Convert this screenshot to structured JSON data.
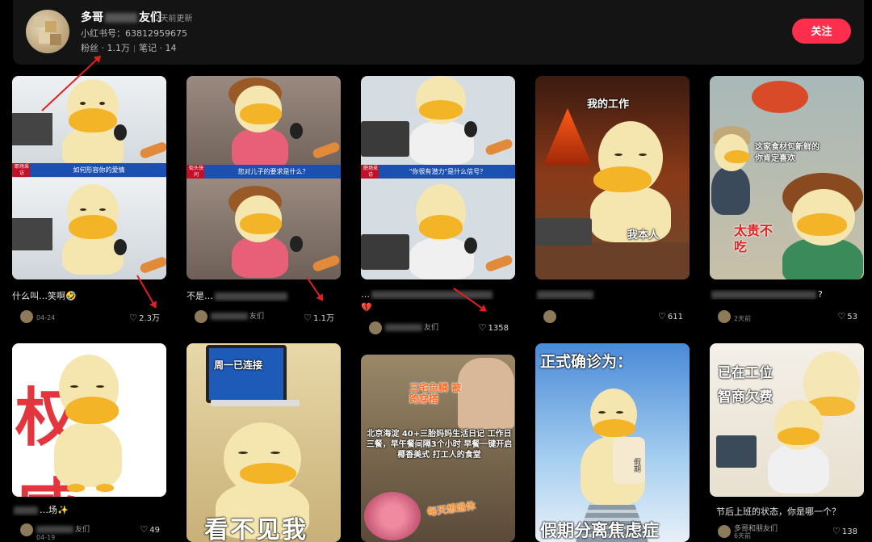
{
  "profile": {
    "name_prefix": "多哥",
    "name_suffix": "友们",
    "updated": "2天前更新",
    "id_text": "小红书号：63812959675",
    "fans": "粉丝 · 1.1万",
    "notes": "笔记 · 14",
    "follow_label": "关注"
  },
  "cards": [
    {
      "banner_tag": "职场采访",
      "banner_text": "如何形容你的爱情",
      "caption": "什么叫…笑啊🤣",
      "likes": "2.3万",
      "date": "04-24",
      "author": ""
    },
    {
      "banner_tag": "街头快问",
      "banner_text": "您对儿子的要求是什么？",
      "caption": "不是…",
      "likes": "1.1万",
      "author": "友们"
    },
    {
      "banner_tag": "职场采访",
      "banner_text": "\"你很有潜力\"是什么信号？",
      "caption": "…",
      "sub_caption": "💔",
      "likes": "1358",
      "author": "友们"
    },
    {
      "overlay_top": "我的工作",
      "overlay_bottom": "我本人",
      "caption": "",
      "likes": "611"
    },
    {
      "overlay_top": "这家食材包新鲜的你肯定喜欢",
      "overlay_bottom": "太贵不吃",
      "caption": "?",
      "likes": "53",
      "date": "2天前"
    },
    {
      "overlay_big": "权威",
      "caption": "…场✨",
      "likes": "49",
      "date": "04-19",
      "author": "友们"
    },
    {
      "overlay_top": "周一已连接",
      "overlay_bottom": "看不见我",
      "caption": "",
      "likes": ""
    },
    {
      "overlay_top": "三宅鱼鳞 被跨穿搭",
      "overlay_mid": "北京海淀 40+三胎妈妈生活日记 工作日三餐，早午餐间隔3个小时 早餐一键开启椰香美式 打工人的食堂",
      "overlay_bottom": "每天想退休",
      "caption": "",
      "likes": ""
    },
    {
      "overlay_top": "正式确诊为：",
      "overlay_bottom": "假期分离焦虑症",
      "pillow_text": "假期",
      "caption": "",
      "likes": ""
    },
    {
      "overlay_top": "已在工位",
      "overlay_mid": "智商欠费",
      "caption": "节后上班的状态，你是哪一个？",
      "likes": "138",
      "author": "多哥和朋友们",
      "date": "6天前"
    }
  ]
}
